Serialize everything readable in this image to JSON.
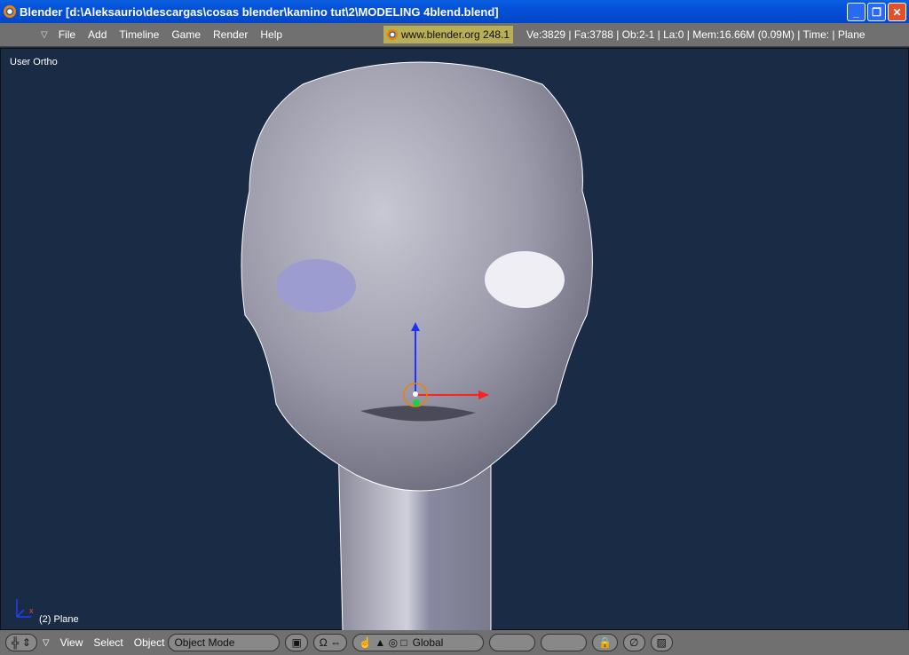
{
  "window": {
    "title": "Blender [d:\\Aleksaurio\\descargas\\cosas blender\\kamino tut\\2\\MODELING 4blend.blend]"
  },
  "menu": {
    "items": [
      "File",
      "Add",
      "Timeline",
      "Game",
      "Render",
      "Help"
    ],
    "site": "www.blender.org 248.1",
    "stats": "Ve:3829 | Fa:3788 | Ob:2-1 | La:0  | Mem:16.66M (0.09M)  | Time: | Plane"
  },
  "viewport": {
    "view_label": "User Ortho",
    "object_label": "(2) Plane",
    "background": "#1a2c45"
  },
  "toolbar": {
    "menus": [
      "View",
      "Select",
      "Object"
    ],
    "mode": "Object Mode",
    "orientation": "Global"
  }
}
